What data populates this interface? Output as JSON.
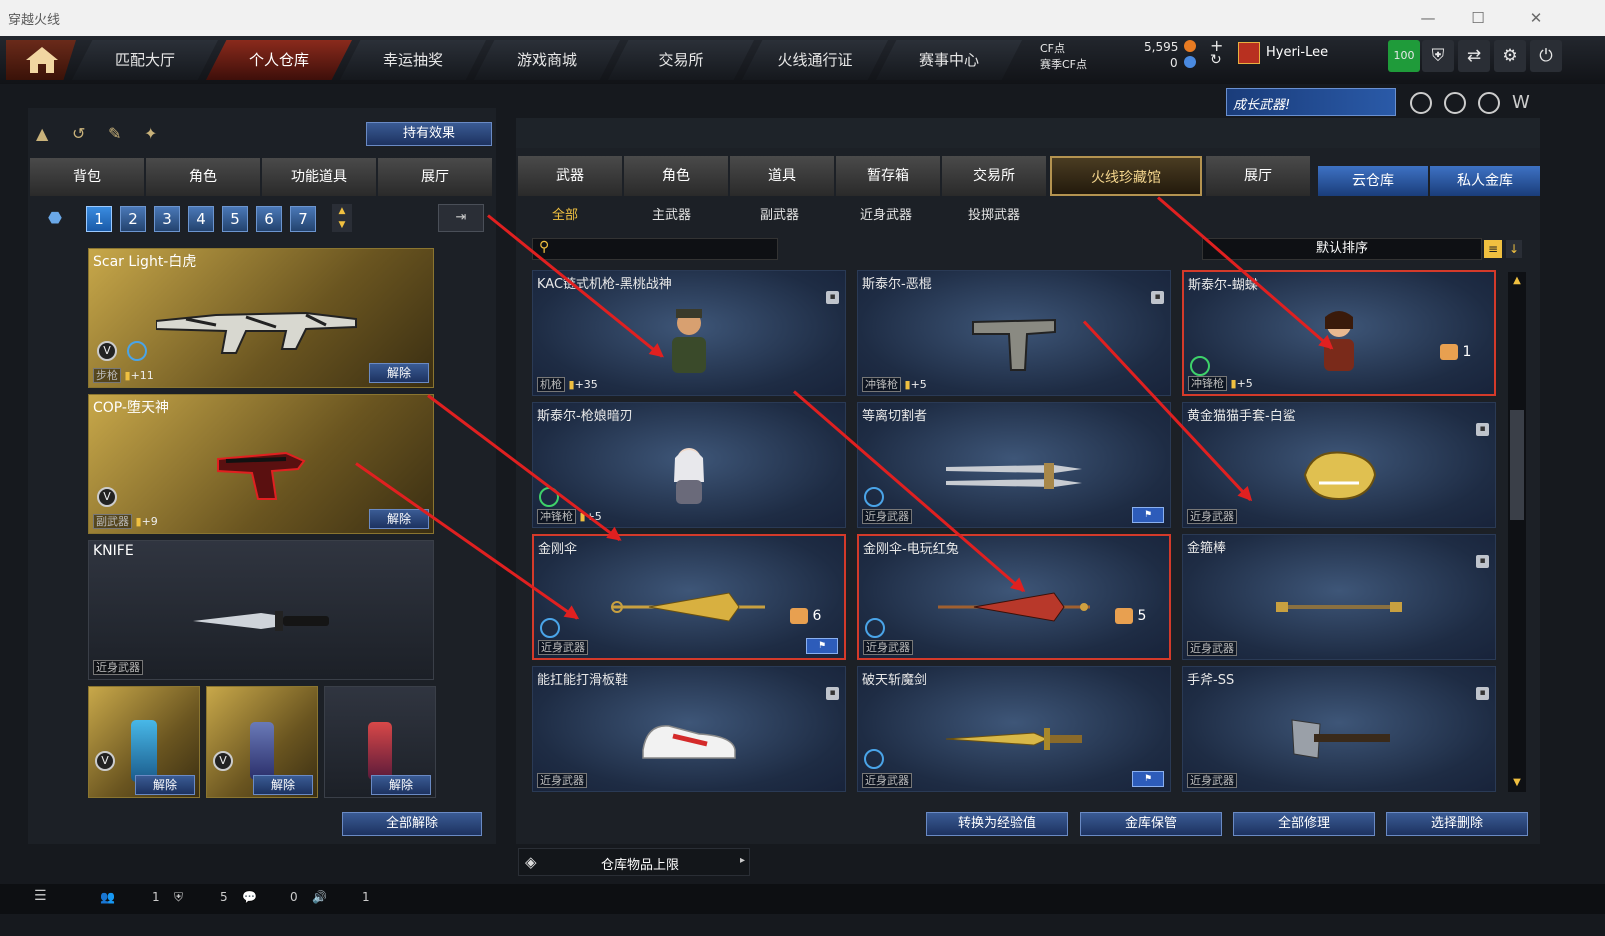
{
  "window": {
    "title": "穿越火线",
    "minimize": "—",
    "maximize": "☐",
    "close": "✕"
  },
  "nav": {
    "home": "home-icon",
    "tabs": [
      "匹配大厅",
      "个人仓库",
      "幸运抽奖",
      "游戏商城",
      "交易所",
      "火线通行证",
      "赛事中心"
    ],
    "active_index": 1
  },
  "currency": {
    "cf_label": "CF点",
    "cf_value": "5,595",
    "ticket_label": "赛季CF点",
    "ticket_value": "0",
    "plus": "+",
    "refresh": "↻"
  },
  "user": {
    "name": "Hyeri-Lee",
    "level_badge": "100"
  },
  "banner": {
    "text": "成长武器!"
  },
  "left": {
    "effect_btn": "持有效果",
    "tabs": [
      "背包",
      "角色",
      "功能道具",
      "展厅"
    ],
    "pages": [
      "1",
      "2",
      "3",
      "4",
      "5",
      "6",
      "7"
    ],
    "slots": [
      {
        "name": "Scar Light-白虎",
        "type": "步枪",
        "bonus": "+11",
        "release": "解除"
      },
      {
        "name": "COP-堕天神",
        "type": "副武器",
        "bonus": "+9",
        "release": "解除"
      },
      {
        "name": "KNIFE",
        "type": "近身武器"
      }
    ],
    "grenades": [
      {
        "release": "解除"
      },
      {
        "release": "解除"
      },
      {
        "release": "解除"
      }
    ],
    "release_all": "全部解除"
  },
  "right": {
    "tabs": [
      "武器",
      "角色",
      "道具",
      "暂存箱",
      "交易所",
      "火线珍藏馆",
      "展厅"
    ],
    "active_tab": 5,
    "blue_tabs": [
      "云仓库",
      "私人金库"
    ],
    "subtabs": [
      "全部",
      "主武器",
      "副武器",
      "近身武器",
      "投掷武器"
    ],
    "sort": "默认排序",
    "items": [
      {
        "name": "KAC链式机枪-黑桃战神",
        "type": "机枪",
        "bonus": "+35"
      },
      {
        "name": "斯泰尔-恶棍",
        "type": "冲锋枪",
        "bonus": "+5"
      },
      {
        "name": "斯泰尔-蝴蝶",
        "type": "冲锋枪",
        "bonus": "+5",
        "count": "1"
      },
      {
        "name": "斯泰尔-枪娘暗刃",
        "type": "冲锋枪",
        "bonus": "+5"
      },
      {
        "name": "等离切割者",
        "type": "近身武器"
      },
      {
        "name": "黄金猫猫手套-白鲨",
        "type": "近身武器"
      },
      {
        "name": "金刚伞",
        "type": "近身武器",
        "count": "6"
      },
      {
        "name": "金刚伞-电玩红兔",
        "type": "近身武器",
        "count": "5"
      },
      {
        "name": "金箍棒",
        "type": "近身武器"
      },
      {
        "name": "能扛能打滑板鞋",
        "type": "近身武器"
      },
      {
        "name": "破天斩魔剑",
        "type": "近身武器"
      },
      {
        "name": "手斧-SS",
        "type": "近身武器"
      }
    ],
    "bottom_buttons": [
      "转换为经验值",
      "金库保管",
      "全部修理",
      "选择删除"
    ],
    "capacity": "仓库物品上限"
  },
  "status": {
    "friends": "1",
    "clan": "5",
    "chat": "0",
    "sound": "1"
  }
}
